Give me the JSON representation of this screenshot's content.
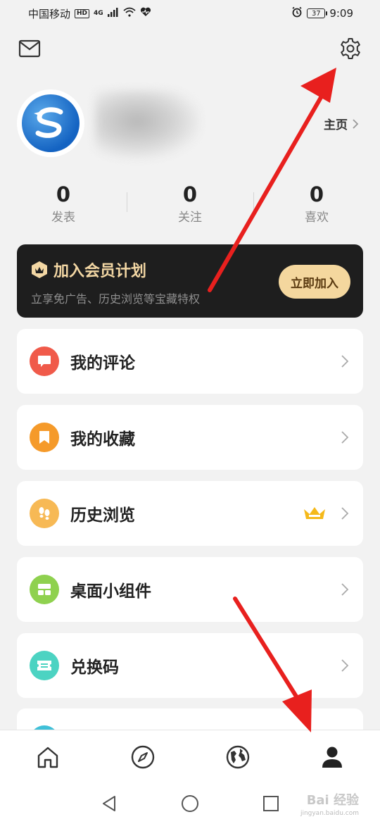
{
  "status_bar": {
    "carrier": "中国移动",
    "hd": "HD",
    "network": "4G",
    "battery": "37",
    "time": "9:09"
  },
  "header": {
    "mail_icon": "mail-icon",
    "settings_icon": "gear-icon"
  },
  "profile": {
    "homepage_label": "主页"
  },
  "stats": [
    {
      "value": "0",
      "label": "发表"
    },
    {
      "value": "0",
      "label": "关注"
    },
    {
      "value": "0",
      "label": "喜欢"
    }
  ],
  "member": {
    "title": "加入会员计划",
    "subtitle": "立享免广告、历史浏览等宝藏特权",
    "join_label": "立即加入"
  },
  "menu": [
    {
      "label": "我的评论",
      "icon": "comment-icon",
      "color": "#f05a4a"
    },
    {
      "label": "我的收藏",
      "icon": "bookmark-icon",
      "color": "#f59a2a"
    },
    {
      "label": "历史浏览",
      "icon": "footprints-icon",
      "color": "#f7b955",
      "vip": true
    },
    {
      "label": "桌面小组件",
      "icon": "widget-icon",
      "color": "#8fd14f"
    },
    {
      "label": "兑换码",
      "icon": "ticket-icon",
      "color": "#4cd3c2"
    }
  ],
  "bottom_nav": [
    "home-icon",
    "compass-icon",
    "globe-icon",
    "user-icon"
  ],
  "watermark": {
    "text": "Bai 经验",
    "sub": "jingyan.baidu.com"
  },
  "colors": {
    "background": "#f2f2f2",
    "accent_gold": "#f4d79e",
    "arrow": "#e8201e"
  }
}
